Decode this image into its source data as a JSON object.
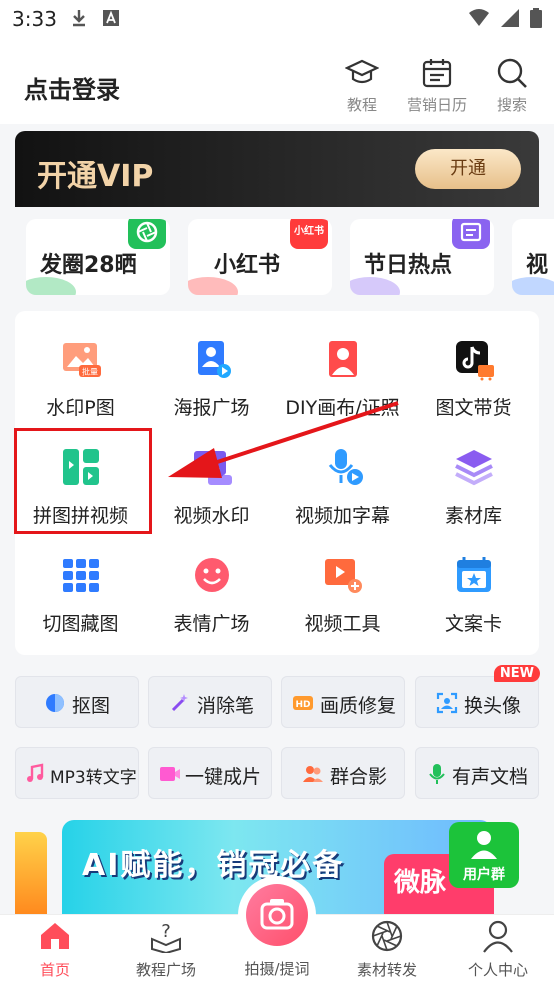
{
  "status_bar": {
    "time": "3:33"
  },
  "header": {
    "login_label": "点击登录",
    "actions": [
      {
        "label": "教程",
        "icon": "graduation-cap-icon"
      },
      {
        "label": "营销日历",
        "icon": "calendar-icon"
      },
      {
        "label": "搜索",
        "icon": "search-icon"
      }
    ]
  },
  "vip": {
    "title": "开通VIP",
    "button": "开通"
  },
  "quick_cards": [
    {
      "label": "发圈28晒",
      "badge_color": "#22c05a"
    },
    {
      "label": "小红书",
      "badge_color": "#ff3b3b",
      "badge_text": "小红书"
    },
    {
      "label": "节日热点",
      "badge_color": "#8a63f0"
    },
    {
      "label": "视",
      "badge_color": "#4d8dff"
    }
  ],
  "grid": [
    {
      "label": "水印P图",
      "icon": "watermark-photo-icon",
      "color": "#ff7a5c",
      "badge": "批量"
    },
    {
      "label": "海报广场",
      "icon": "poster-icon",
      "color": "#2f7bff"
    },
    {
      "label": "DIY画布/证照",
      "icon": "portrait-canvas-icon",
      "color": "#ff4b4b"
    },
    {
      "label": "图文带货",
      "icon": "douyin-cart-icon",
      "color": "#111111"
    },
    {
      "label": "拼图拼视频",
      "icon": "collage-video-icon",
      "color": "#21c48c"
    },
    {
      "label": "视频水印",
      "icon": "video-watermark-icon",
      "color": "#7b5cf0"
    },
    {
      "label": "视频加字幕",
      "icon": "microphone-caption-icon",
      "color": "#2f9bff"
    },
    {
      "label": "素材库",
      "icon": "layers-icon",
      "color": "#8a5cf0"
    },
    {
      "label": "切图藏图",
      "icon": "grid-cut-icon",
      "color": "#2f7bff"
    },
    {
      "label": "表情广场",
      "icon": "emoji-face-icon",
      "color": "#ff5a6e"
    },
    {
      "label": "视频工具",
      "icon": "video-tool-icon",
      "color": "#ff6a3d"
    },
    {
      "label": "文案卡",
      "icon": "calendar-star-icon",
      "color": "#2f9bff"
    }
  ],
  "tools_row1": [
    {
      "label": "抠图",
      "icon": "cutout-icon",
      "color": "#2f7bff"
    },
    {
      "label": "消除笔",
      "icon": "eraser-wand-icon",
      "color": "#8a4cf0"
    },
    {
      "label": "画质修复",
      "icon": "hd-icon",
      "color": "#ff9a2e"
    },
    {
      "label": "换头像",
      "icon": "face-swap-icon",
      "color": "#2f9bff",
      "badge": "NEW"
    }
  ],
  "tools_row2": [
    {
      "label": "MP3转文字",
      "icon": "music-note-icon",
      "color": "#ff5a9e"
    },
    {
      "label": "一键成片",
      "icon": "video-clip-icon",
      "color": "#ff5ad1"
    },
    {
      "label": "群合影",
      "icon": "group-photo-icon",
      "color": "#ff6a3d"
    },
    {
      "label": "有声文档",
      "icon": "microphone-icon",
      "color": "#22c05a"
    }
  ],
  "promo": {
    "title": "AI赋能，销冠必备",
    "tag": "微脉",
    "user_group": "用户群"
  },
  "bottom_nav": [
    {
      "label": "首页",
      "icon": "home-icon",
      "active": true
    },
    {
      "label": "教程广场",
      "icon": "tutorial-book-icon",
      "active": false
    },
    {
      "label": "拍摄/提词",
      "icon": "camera-icon",
      "active": false
    },
    {
      "label": "素材转发",
      "icon": "aperture-icon",
      "active": false
    },
    {
      "label": "个人中心",
      "icon": "user-icon",
      "active": false
    }
  ]
}
